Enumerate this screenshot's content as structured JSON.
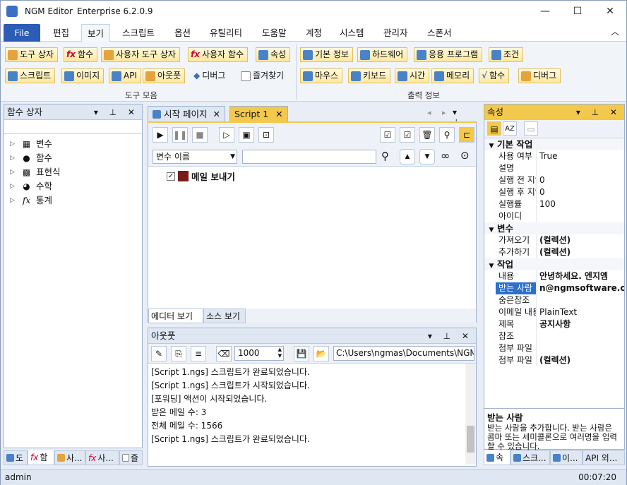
{
  "window": {
    "app_name": "NGM Editor",
    "edition": "Enterprise 6.2.0.9",
    "min": "—",
    "max": "☐",
    "close": "✕"
  },
  "menu": {
    "file": "File",
    "tabs": [
      "편집",
      "보기",
      "스크립트",
      "옵션",
      "유틸리티",
      "도움말",
      "계정",
      "시스템",
      "관리자",
      "스폰서"
    ],
    "active": "보기",
    "collapse": "︿"
  },
  "ribbon": {
    "row1": [
      "도구 상자",
      "함수",
      "사용자 도구 상자",
      "사용자 함수",
      "속성"
    ],
    "row2": [
      "스크립트",
      "이미지",
      "API",
      "아웃풋",
      "디버그",
      "즐겨찾기"
    ],
    "row1b": [
      "기본 정보",
      "하드웨어",
      "응용 프로그램",
      "조건"
    ],
    "row2b": [
      "마우스",
      "키보드",
      "시간",
      "메모리",
      "함수",
      "디버그"
    ],
    "group1": "도구 모음",
    "group2": "출력 정보"
  },
  "left_pane": {
    "title": "함수 상자",
    "items": [
      "변수",
      "함수",
      "표현식",
      "수학",
      "통계"
    ]
  },
  "editor": {
    "tabs": [
      "시작 페이지",
      "Script 1"
    ],
    "active_tab": "Script 1",
    "var_select": "변수 이름",
    "search_value": "",
    "action": "메일 보내기",
    "bottom_tabs": [
      "에디터 보기",
      "소스 보기"
    ]
  },
  "output": {
    "title": "아웃풋",
    "count": "1000",
    "path": "C:\\Users\\ngmas\\Documents\\NGM6\\",
    "lines": [
      "[Script 1.ngs] 스크립트가 완료되었습니다.",
      "[Script 1.ngs] 스크립트가 시작되었습니다.",
      "[포워딩] 액션이 시작되었습니다.",
      "받은 메일 수: 3",
      "전체 메일 수: 1566",
      "[Script 1.ngs] 스크립트가 완료되었습니다."
    ]
  },
  "properties": {
    "title": "속성",
    "groups": [
      {
        "name": "기본 작업",
        "rows": [
          [
            "사용 여부",
            "True"
          ],
          [
            "설명",
            ""
          ],
          [
            "실행 전 지연",
            "0"
          ],
          [
            "실행 후 지연",
            "0"
          ],
          [
            "실행률",
            "100"
          ],
          [
            "아이디",
            ""
          ]
        ]
      },
      {
        "name": "변수",
        "rows": [
          [
            "가져오기",
            "(컬렉션)"
          ],
          [
            "추가하기",
            "(컬렉션)"
          ]
        ]
      },
      {
        "name": "작업",
        "rows": [
          [
            "내용",
            "안녕하세요. 엔지엠"
          ],
          [
            "받는 사람",
            "n@ngmsoftware.c"
          ],
          [
            "숨은참조",
            ""
          ],
          [
            "이메일 내용 형식",
            "PlainText"
          ],
          [
            "제목",
            "공지사항"
          ],
          [
            "참조",
            ""
          ],
          [
            "첨부 파일",
            ""
          ],
          [
            "첨부 파일",
            "(컬렉션)"
          ]
        ]
      }
    ],
    "desc_title": "받는 사람",
    "desc_text": "받는 사람을 추가합니다. 받는 사람은 콤마 또는 세미콜론으로 여러명을 입력할 수 있습니다."
  },
  "bottom_left_tabs": [
    "도",
    "함",
    "사...",
    "사...",
    "즐"
  ],
  "bottom_right_tabs": [
    "속",
    "스크...",
    "이...",
    "API 외..."
  ],
  "status": {
    "user": "admin",
    "time": "00:07:20"
  }
}
